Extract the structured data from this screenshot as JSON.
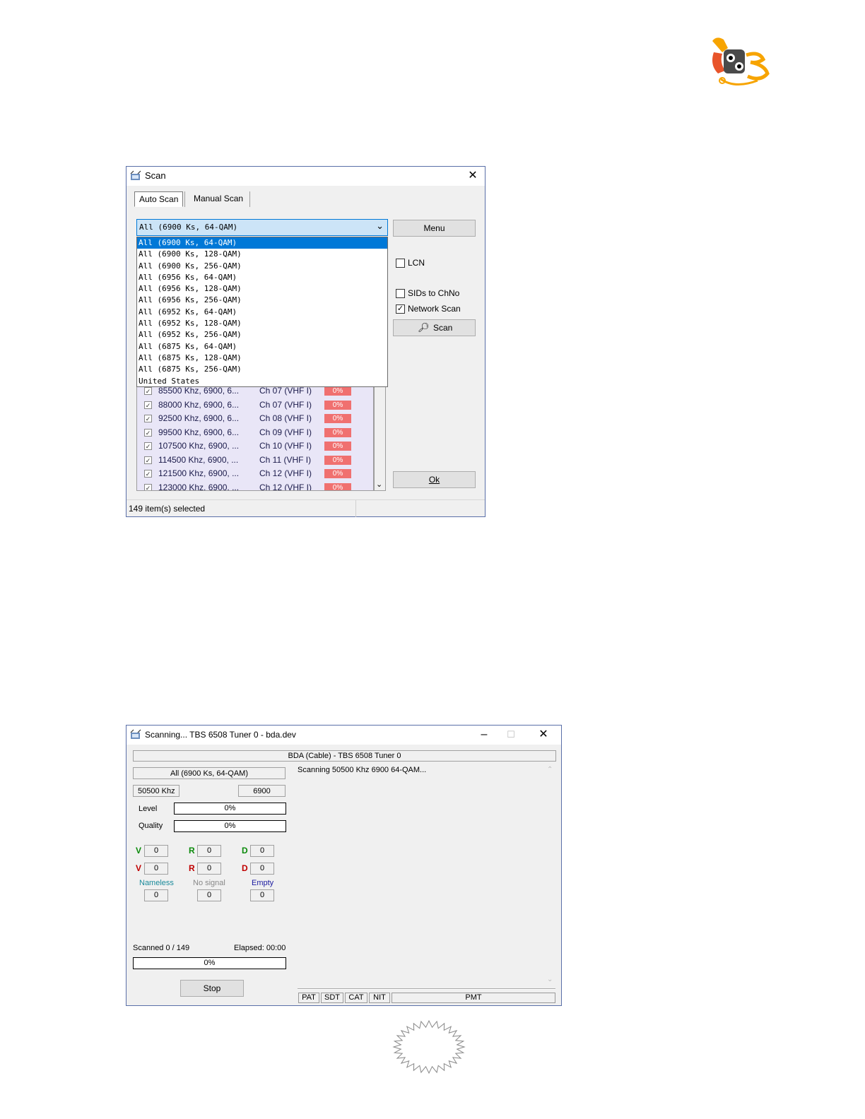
{
  "colors": {
    "accent_blue": "#0078d7",
    "signal_red": "#f07070",
    "list_bg": "#e9e6f7",
    "green_letter": "#0a8a0a",
    "red_letter": "#c00000",
    "teal_label": "#1a8a9a",
    "blue_label": "#1a1aa0"
  },
  "scan_window": {
    "title": "Scan",
    "tabs": [
      {
        "label": "Auto Scan"
      },
      {
        "label": "Manual Scan"
      }
    ],
    "combo_value": "All (6900 Ks, 64-QAM)",
    "dropdown_options": [
      "All (6900 Ks, 64-QAM)",
      "All (6900 Ks, 128-QAM)",
      "All (6900 Ks, 256-QAM)",
      "All (6956 Ks, 64-QAM)",
      "All (6956 Ks, 128-QAM)",
      "All (6956 Ks, 256-QAM)",
      "All (6952 Ks, 64-QAM)",
      "All (6952 Ks, 128-QAM)",
      "All (6952 Ks, 256-QAM)",
      "All (6875 Ks, 64-QAM)",
      "All (6875 Ks, 128-QAM)",
      "All (6875 Ks, 256-QAM)",
      "United States"
    ],
    "menu_label": "Menu",
    "lcn_label": "LCN",
    "sids_label": "SIDs to ChNo",
    "network_scan_label": "Network Scan",
    "scan_label": "Scan",
    "ok_label": "Ok",
    "channels": [
      {
        "freq": "85500 Khz, 6900, 6...",
        "ch": "Ch 07  (VHF I)",
        "pct": "0%"
      },
      {
        "freq": "88000 Khz, 6900, 6...",
        "ch": "Ch 07  (VHF I)",
        "pct": "0%"
      },
      {
        "freq": "92500 Khz, 6900, 6...",
        "ch": "Ch 08  (VHF I)",
        "pct": "0%"
      },
      {
        "freq": "99500 Khz, 6900, 6...",
        "ch": "Ch 09  (VHF I)",
        "pct": "0%"
      },
      {
        "freq": "107500 Khz, 6900, ...",
        "ch": "Ch 10  (VHF I)",
        "pct": "0%"
      },
      {
        "freq": "114500 Khz, 6900, ...",
        "ch": "Ch 11  (VHF I)",
        "pct": "0%"
      },
      {
        "freq": "121500 Khz, 6900, ...",
        "ch": "Ch 12  (VHF I)",
        "pct": "0%"
      },
      {
        "freq": "123000 Khz, 6900, ...",
        "ch": "Ch 12  (VHF I)",
        "pct": "0%"
      }
    ],
    "status": "149 item(s) selected"
  },
  "scanning_window": {
    "title": "Scanning...  TBS 6508 Tuner 0 - bda.dev",
    "device": "BDA (Cable)  -  TBS 6508 Tuner 0",
    "preset": "All (6900 Ks, 64-QAM)",
    "frequency": "50500 Khz",
    "symbol_rate": "6900",
    "level_label": "Level",
    "level_value": "0%",
    "quality_label": "Quality",
    "quality_value": "0%",
    "counters_row1": [
      {
        "letter": "V",
        "value": "0"
      },
      {
        "letter": "R",
        "value": "0"
      },
      {
        "letter": "D",
        "value": "0"
      }
    ],
    "counters_row2": [
      {
        "letter": "V",
        "value": "0"
      },
      {
        "letter": "R",
        "value": "0"
      },
      {
        "letter": "D",
        "value": "0"
      }
    ],
    "nameless_label": "Nameless",
    "nameless_value": "0",
    "nosignal_label": "No signal",
    "nosignal_value": "0",
    "empty_label": "Empty",
    "empty_value": "0",
    "scanned_text": "Scanned 0 / 149",
    "elapsed_text": "Elapsed: 00:00",
    "progress_value": "0%",
    "stop_label": "Stop",
    "log_text": "Scanning 50500 Khz  6900 64-QAM...",
    "table_tabs": [
      "PAT",
      "SDT",
      "CAT",
      "NIT",
      "PMT"
    ]
  }
}
